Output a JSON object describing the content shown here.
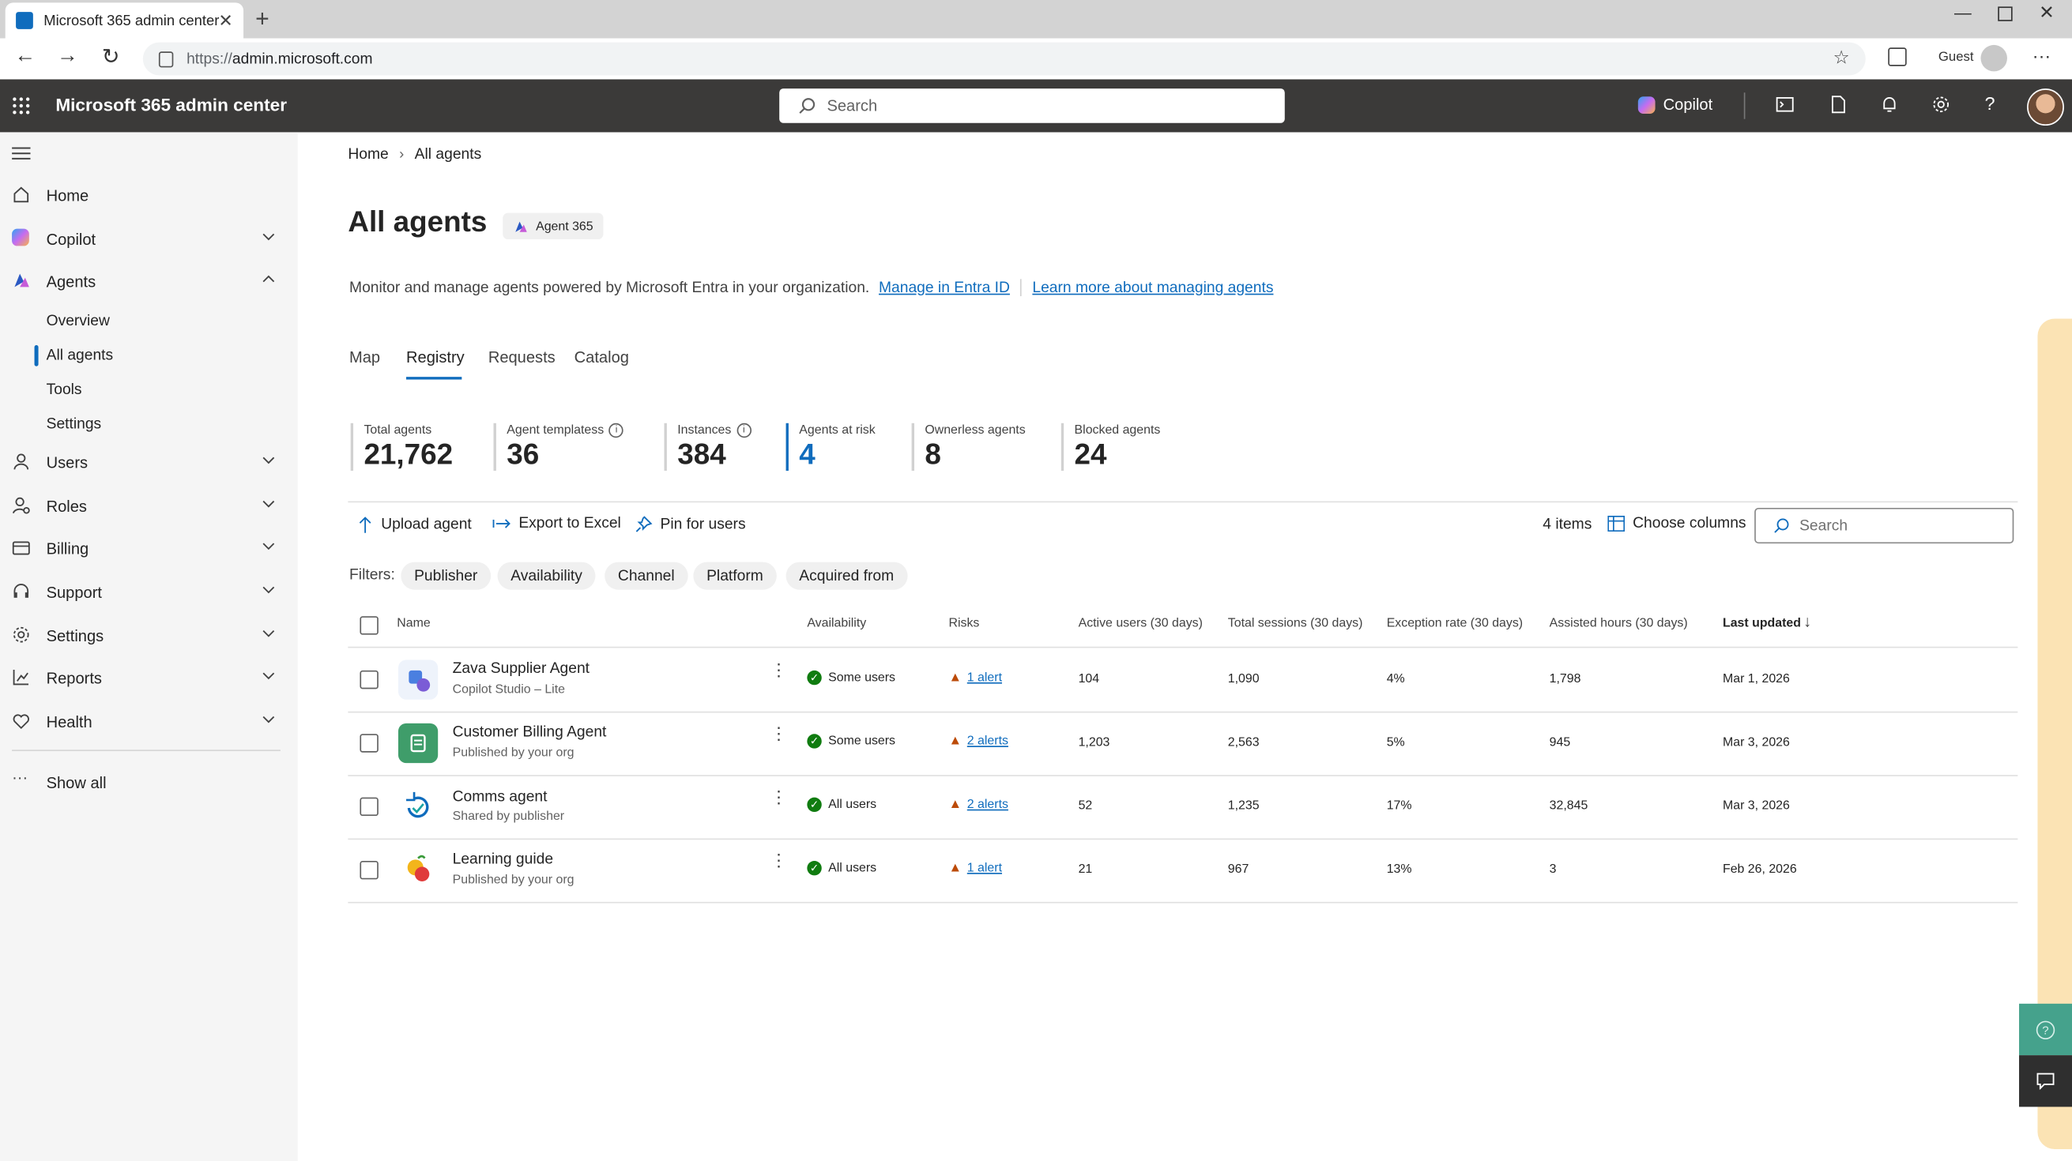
{
  "browser": {
    "tab_title": "Microsoft 365 admin center",
    "url_prefix": "https://",
    "url_host": "admin.microsoft.com",
    "guest_label": "Guest"
  },
  "header": {
    "app_title": "Microsoft 365 admin center",
    "search_placeholder": "Search",
    "copilot_label": "Copilot"
  },
  "sidebar": {
    "items": [
      {
        "label": "Home"
      },
      {
        "label": "Copilot"
      },
      {
        "label": "Agents"
      },
      {
        "label": "Users"
      },
      {
        "label": "Roles"
      },
      {
        "label": "Billing"
      },
      {
        "label": "Support"
      },
      {
        "label": "Settings"
      },
      {
        "label": "Reports"
      },
      {
        "label": "Health"
      }
    ],
    "agents_sub": [
      "Overview",
      "All agents",
      "Tools",
      "Settings"
    ],
    "show_all": "Show all"
  },
  "breadcrumb": {
    "home": "Home",
    "current": "All agents"
  },
  "page": {
    "title": "All agents",
    "badge": "Agent 365",
    "description": "Monitor and manage agents powered by Microsoft Entra in your organization.",
    "link1": "Manage in Entra ID",
    "link2": "Learn more about managing agents"
  },
  "tabs": [
    "Map",
    "Registry",
    "Requests",
    "Catalog"
  ],
  "metrics": [
    {
      "label": "Total agents",
      "value": "21,762"
    },
    {
      "label": "Agent templatess",
      "value": "36"
    },
    {
      "label": "Instances",
      "value": "384"
    },
    {
      "label": "Agents at risk",
      "value": "4"
    },
    {
      "label": "Ownerless agents",
      "value": "8"
    },
    {
      "label": "Blocked agents",
      "value": "24"
    }
  ],
  "commands": {
    "upload": "Upload agent",
    "export": "Export to Excel",
    "pin": "Pin for users",
    "items_count": "4 items",
    "choose_columns": "Choose columns",
    "search_placeholder": "Search"
  },
  "filters": {
    "label": "Filters:",
    "chips": [
      "Publisher",
      "Availability",
      "Channel",
      "Platform",
      "Acquired from"
    ]
  },
  "table": {
    "columns": [
      "Name",
      "Availability",
      "Risks",
      "Active users (30 days)",
      "Total sessions (30 days)",
      "Exception rate (30 days)",
      "Assisted hours (30 days)",
      "Last updated"
    ],
    "rows": [
      {
        "name": "Zava Supplier Agent",
        "sub": "Copilot Studio – Lite",
        "availability": "Some users",
        "risks": "1 alert",
        "active": "104",
        "sessions": "1,090",
        "exception": "4%",
        "hours": "1,798",
        "updated": "Mar 1, 2026"
      },
      {
        "name": "Customer Billing Agent",
        "sub": "Published by your org",
        "availability": "Some users",
        "risks": "2 alerts",
        "active": "1,203",
        "sessions": "2,563",
        "exception": "5%",
        "hours": "945",
        "updated": "Mar 3, 2026"
      },
      {
        "name": "Comms agent",
        "sub": "Shared by publisher",
        "availability": "All users",
        "risks": "2 alerts",
        "active": "52",
        "sessions": "1,235",
        "exception": "17%",
        "hours": "32,845",
        "updated": "Mar 3, 2026"
      },
      {
        "name": "Learning guide",
        "sub": "Published by your org",
        "availability": "All users",
        "risks": "1 alert",
        "active": "21",
        "sessions": "967",
        "exception": "13%",
        "hours": "3",
        "updated": "Feb 26, 2026"
      }
    ]
  },
  "colors": {
    "accent": "#0f6cbd",
    "suite_bar": "#3b3a39",
    "success": "#107c10",
    "warning": "#bc4b09"
  }
}
